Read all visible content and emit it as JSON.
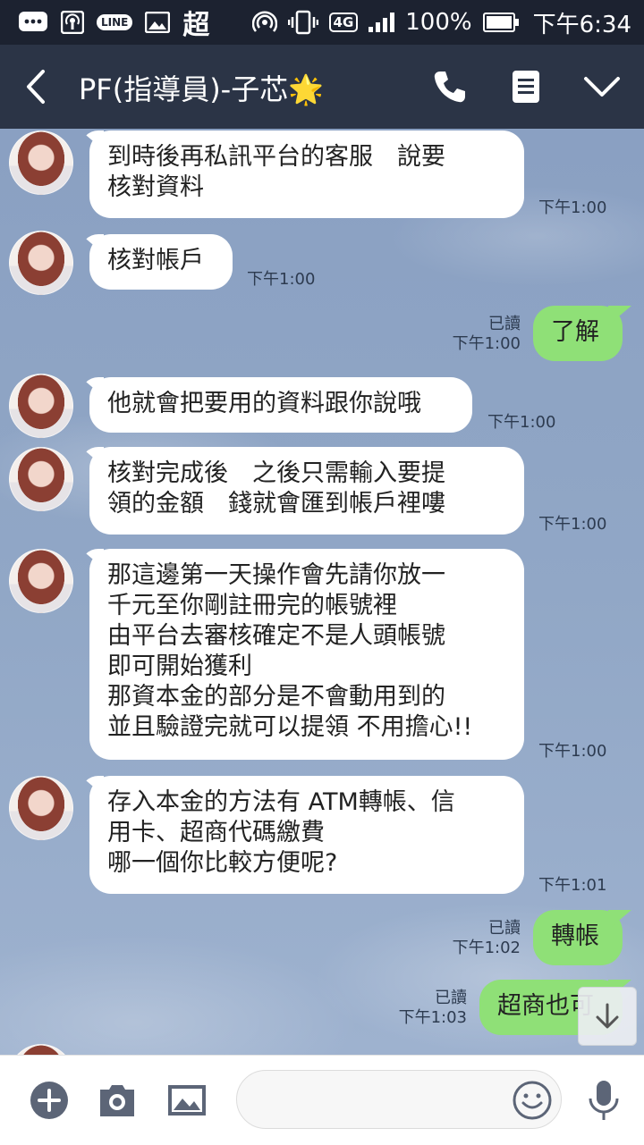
{
  "status_bar": {
    "chao": "超",
    "network": "4G",
    "line_badge": "LINE",
    "battery": "100%",
    "time": "下午6:34"
  },
  "header": {
    "title": "PF(指導員)-子芯",
    "title_emoji": "🌟"
  },
  "messages": [
    {
      "side": "in",
      "text": "到時後再私訊平台的客服　說要\n核對資料",
      "time": "下午1:00"
    },
    {
      "side": "in",
      "text": "核對帳戶",
      "time": "下午1:00"
    },
    {
      "side": "out",
      "text": "了解",
      "read": "已讀",
      "time": "下午1:00"
    },
    {
      "side": "in",
      "text": "他就會把要用的資料跟你說哦",
      "time": "下午1:00"
    },
    {
      "side": "in",
      "text": "核對完成後　之後只需輸入要提\n領的金額　錢就會匯到帳戶裡嘍",
      "time": "下午1:00"
    },
    {
      "side": "in",
      "text": "那這邊第一天操作會先請你放一\n千元至你剛註冊完的帳號裡\n由平台去審核確定不是人頭帳號\n即可開始獲利\n那資本金的部分是不會動用到的\n並且驗證完就可以提領 不用擔心!!",
      "time": "下午1:00"
    },
    {
      "side": "in",
      "text": "存入本金的方法有 ATM轉帳、信\n用卡、超商代碼繳費\n哪一個你比較方便呢?",
      "time": "下午1:01"
    },
    {
      "side": "out",
      "text": "轉帳",
      "read": "已讀",
      "time": "下午1:02"
    },
    {
      "side": "out",
      "text": "超商也可",
      "read": "已讀",
      "time": "下午1:03"
    }
  ],
  "colors": {
    "header_bg": "#2b3446",
    "status_bg": "#1c2230",
    "outgoing_bubble": "#8fe077",
    "incoming_bubble": "#ffffff"
  }
}
